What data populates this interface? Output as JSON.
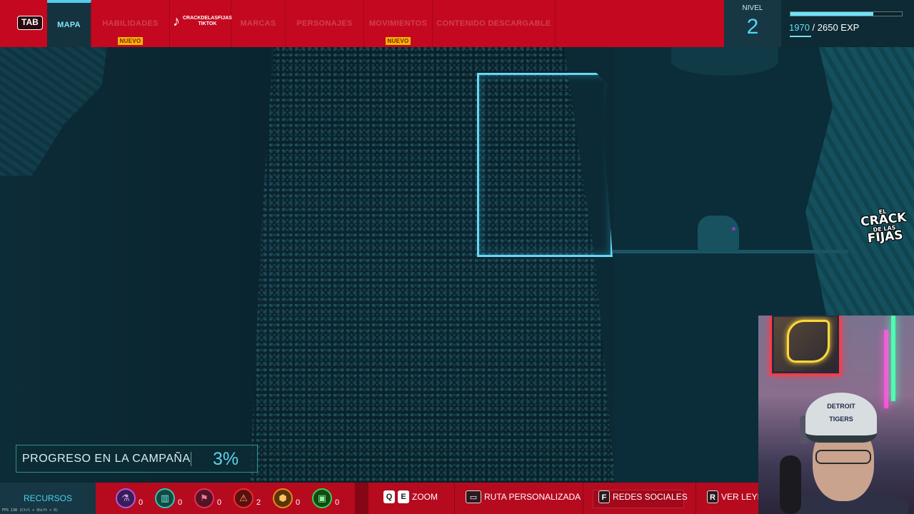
{
  "top_bar": {
    "tab_key": "TAB",
    "nav": [
      {
        "label": "MAPA",
        "active": true,
        "badge": ""
      },
      {
        "label": "HABILIDADES",
        "active": false,
        "badge": "NUEVO"
      },
      {
        "label": "MARCAS",
        "active": false,
        "badge": ""
      },
      {
        "label": "PERSONAJES",
        "active": false,
        "badge": ""
      },
      {
        "label": "MOVIMIENTOS",
        "active": false,
        "badge": "NUEVO"
      },
      {
        "label": "CONTENIDO DESCARGABLE",
        "active": false,
        "badge": ""
      }
    ],
    "social_overlay": {
      "icon": "tiktok-icon",
      "handle_line1": "CRACKDELASFIJAS",
      "handle_line2": "TIKTOK"
    },
    "level": {
      "label": "NIVEL",
      "value": "2"
    },
    "exp": {
      "current": "1970",
      "separator": " / ",
      "total": "2650 EXP",
      "progress": 0.743
    }
  },
  "map": {
    "highlight_color": "#6ad6f2",
    "marker_color": "#8a3fbf"
  },
  "logo": {
    "line1": "EL",
    "line2": "CRACK",
    "line3": "DE LAS",
    "line4": "FIJAS"
  },
  "campaign_progress": {
    "label": "PROGRESO EN LA CAMPAÑA",
    "value": "3%"
  },
  "bottom_bar": {
    "resources_label": "RECURSOS",
    "resources": [
      {
        "icon": "research-icon",
        "count": "0"
      },
      {
        "icon": "hideout-icon",
        "count": "0"
      },
      {
        "icon": "flag-icon",
        "count": "0"
      },
      {
        "icon": "crime-warning-icon",
        "count": "2"
      },
      {
        "icon": "base-icon",
        "count": "0"
      },
      {
        "icon": "backpack-icon",
        "count": "0"
      }
    ],
    "hints": {
      "zoom_keys": [
        "Q",
        "E"
      ],
      "zoom_label": "ZOOM",
      "route_label": "RUTA PERSONALIZADA",
      "social_key": "F",
      "social_label": "REDES SOCIALES",
      "legend_key": "R",
      "legend_label": "VER LEYENDA"
    },
    "fps_text": "FPS 138   (Ctrl + Shift + O)"
  },
  "webcam": {
    "cap_text_line1": "DETROIT",
    "cap_text_line2": "TIGERS"
  },
  "colors": {
    "primary_red": "#c4081f",
    "accent_cyan": "#52d6f2",
    "badge_yellow": "#f2b705"
  }
}
